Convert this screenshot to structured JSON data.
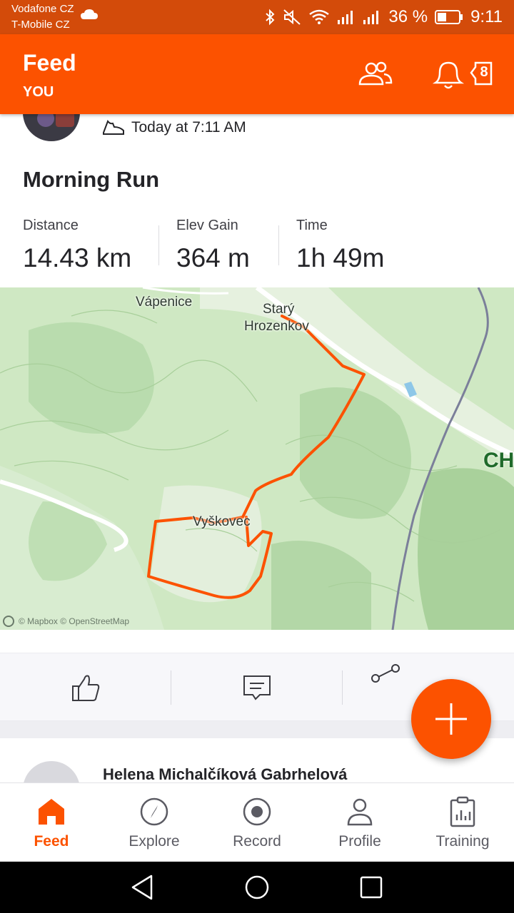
{
  "status_bar": {
    "carrier_1": "Vodafone CZ",
    "carrier_2": "T-Mobile CZ",
    "battery": "36 %",
    "time": "9:11"
  },
  "header": {
    "title": "Feed",
    "subtitle": "YOU",
    "notification_count": "8",
    "bg_color": "#fc5200"
  },
  "activity": {
    "timestamp": "Today at 7:11 AM",
    "title": "Morning Run",
    "stats": [
      {
        "label": "Distance",
        "value": "14.43 km"
      },
      {
        "label": "Elev Gain",
        "value": "364 m"
      },
      {
        "label": "Time",
        "value": "1h 49m"
      }
    ]
  },
  "map": {
    "labels": {
      "vapenice": "Vápenice",
      "stary": "Starý",
      "hrozenkov": "Hrozenkov",
      "vyskovec": "Vyškovec",
      "ch": "CH"
    },
    "attribution": "© Mapbox © OpenStreetMap",
    "route_color": "#fc5200"
  },
  "next_post": {
    "author": "Helena Michalčíková Gabrhelová"
  },
  "bottom_nav": [
    {
      "label": "Feed",
      "icon": "home-icon",
      "active": true
    },
    {
      "label": "Explore",
      "icon": "compass-icon",
      "active": false
    },
    {
      "label": "Record",
      "icon": "record-icon",
      "active": false
    },
    {
      "label": "Profile",
      "icon": "person-icon",
      "active": false
    },
    {
      "label": "Training",
      "icon": "clipboard-chart-icon",
      "active": false
    }
  ]
}
